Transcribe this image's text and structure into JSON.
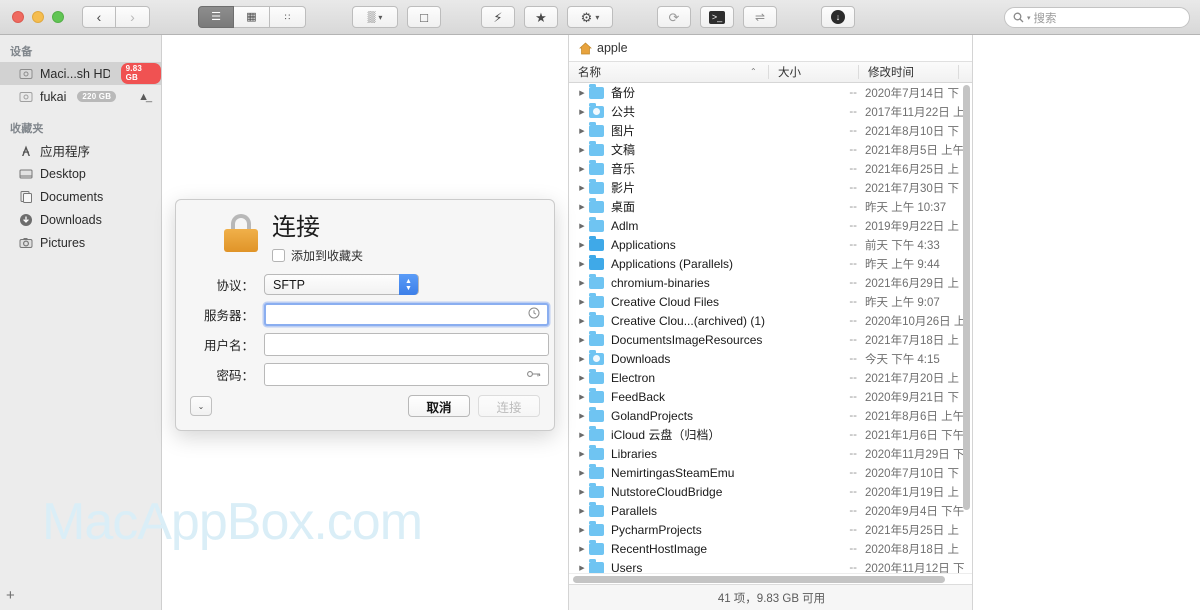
{
  "window": {
    "traffic_lights": [
      "close",
      "minimize",
      "zoom"
    ],
    "nav": {
      "back": "‹",
      "forward": "›"
    }
  },
  "toolbar": {
    "view_modes": [
      {
        "name": "list-view",
        "glyph": "☰",
        "active": true
      },
      {
        "name": "column-view",
        "glyph": "▦",
        "active": false
      },
      {
        "name": "gallery-view",
        "glyph": "∷",
        "active": false
      }
    ],
    "group_actions": [
      {
        "name": "arrange-button",
        "glyph": "▒",
        "has_chevron": true
      },
      {
        "name": "new-document-button",
        "glyph": "□",
        "has_chevron": false
      },
      {
        "name": "quick-action-button",
        "glyph": "⚡",
        "has_chevron": false
      },
      {
        "name": "favorites-button",
        "glyph": "★",
        "has_chevron": false
      },
      {
        "name": "settings-button",
        "glyph": "⚙",
        "has_chevron": true
      },
      {
        "name": "refresh-button",
        "glyph": "⟳",
        "has_chevron": false
      },
      {
        "name": "terminal-button",
        "glyph": "⬛",
        "has_chevron": false
      },
      {
        "name": "sync-button",
        "glyph": "⇌",
        "has_chevron": false
      },
      {
        "name": "download-button",
        "glyph": "↓",
        "has_chevron": false
      }
    ],
    "search": {
      "placeholder": "搜索",
      "icon": "search-icon"
    }
  },
  "sidebar": {
    "sections": [
      {
        "title": "设备",
        "items": [
          {
            "label": "Maci...sh HD",
            "icon": "hard-drive-icon",
            "badge": "9.83 GB",
            "badge_color": "#f05252",
            "selected": true,
            "eject": false
          },
          {
            "label": "fukai",
            "icon": "hard-drive-icon",
            "badge": "220 GB",
            "badge_color": "#b9b9b9",
            "selected": false,
            "eject": true
          }
        ]
      },
      {
        "title": "收藏夹",
        "items": [
          {
            "label": "应用程序",
            "icon": "applications-icon",
            "badge": "",
            "selected": false,
            "eject": false
          },
          {
            "label": "Desktop",
            "icon": "desktop-icon",
            "badge": "",
            "selected": false,
            "eject": false
          },
          {
            "label": "Documents",
            "icon": "documents-icon",
            "badge": "",
            "selected": false,
            "eject": false
          },
          {
            "label": "Downloads",
            "icon": "downloads-icon",
            "badge": "",
            "selected": false,
            "eject": false
          },
          {
            "label": "Pictures",
            "icon": "pictures-icon",
            "badge": "",
            "selected": false,
            "eject": false
          }
        ]
      }
    ],
    "add_button": "+"
  },
  "watermark": {
    "text": "MacAppBox.com",
    "color": "#daeef7"
  },
  "filepanel": {
    "path": {
      "icon": "home-icon",
      "name": "apple"
    },
    "columns": [
      {
        "label": "名称",
        "sorted": true,
        "sort_caret": "⌃"
      },
      {
        "label": "大小",
        "sorted": false,
        "sort_caret": ""
      },
      {
        "label": "修改时间",
        "sorted": false,
        "sort_caret": ""
      }
    ],
    "rows": [
      {
        "name": "备份",
        "size": "--",
        "date": "2020年7月14日 下",
        "icon_variant": "plain"
      },
      {
        "name": "公共",
        "size": "--",
        "date": "2017年11月22日 上",
        "icon_variant": "dot"
      },
      {
        "name": "图片",
        "size": "--",
        "date": "2021年8月10日 下",
        "icon_variant": "plain"
      },
      {
        "name": "文稿",
        "size": "--",
        "date": "2021年8月5日 上午",
        "icon_variant": "plain"
      },
      {
        "name": "音乐",
        "size": "--",
        "date": "2021年6月25日 上",
        "icon_variant": "plain"
      },
      {
        "name": "影片",
        "size": "--",
        "date": "2021年7月30日 下",
        "icon_variant": "plain"
      },
      {
        "name": "桌面",
        "size": "--",
        "date": "昨天 上午 10:37",
        "icon_variant": "plain"
      },
      {
        "name": "Adlm",
        "size": "--",
        "date": "2019年9月22日 上",
        "icon_variant": "plain"
      },
      {
        "name": "Applications",
        "size": "--",
        "date": "前天 下午 4:33",
        "icon_variant": "dark"
      },
      {
        "name": "Applications (Parallels)",
        "size": "--",
        "date": "昨天 上午 9:44",
        "icon_variant": "dark"
      },
      {
        "name": "chromium-binaries",
        "size": "--",
        "date": "2021年6月29日 上",
        "icon_variant": "plain"
      },
      {
        "name": "Creative Cloud Files",
        "size": "--",
        "date": "昨天 上午 9:07",
        "icon_variant": "plain"
      },
      {
        "name": "Creative Clou...(archived) (1)",
        "size": "--",
        "date": "2020年10月26日 上",
        "icon_variant": "plain"
      },
      {
        "name": "DocumentsImageResources",
        "size": "--",
        "date": "2021年7月18日 上",
        "icon_variant": "plain"
      },
      {
        "name": "Downloads",
        "size": "--",
        "date": "今天 下午 4:15",
        "icon_variant": "dot"
      },
      {
        "name": "Electron",
        "size": "--",
        "date": "2021年7月20日 上",
        "icon_variant": "plain"
      },
      {
        "name": "FeedBack",
        "size": "--",
        "date": "2020年9月21日 下",
        "icon_variant": "plain"
      },
      {
        "name": "GolandProjects",
        "size": "--",
        "date": "2021年8月6日 上午",
        "icon_variant": "plain"
      },
      {
        "name": "iCloud 云盘（归档）",
        "size": "--",
        "date": "2021年1月6日 下午",
        "icon_variant": "plain"
      },
      {
        "name": "Libraries",
        "size": "--",
        "date": "2020年11月29日 下",
        "icon_variant": "plain"
      },
      {
        "name": "NemirtingasSteamEmu",
        "size": "--",
        "date": "2020年7月10日 下",
        "icon_variant": "plain"
      },
      {
        "name": "NutstoreCloudBridge",
        "size": "--",
        "date": "2020年1月19日 上",
        "icon_variant": "plain"
      },
      {
        "name": "Parallels",
        "size": "--",
        "date": "2020年9月4日 下午",
        "icon_variant": "plain"
      },
      {
        "name": "PycharmProjects",
        "size": "--",
        "date": "2021年5月25日 上",
        "icon_variant": "plain"
      },
      {
        "name": "RecentHostImage",
        "size": "--",
        "date": "2020年8月18日 上",
        "icon_variant": "plain"
      },
      {
        "name": "Users",
        "size": "--",
        "date": "2020年11月12日 下",
        "icon_variant": "plain"
      }
    ],
    "status": "41 项，9.83 GB 可用"
  },
  "dialog": {
    "title": "连接",
    "icon": "lock-icon",
    "favorite_checkbox": {
      "label": "添加到收藏夹",
      "checked": false
    },
    "fields": [
      {
        "label": "协议：",
        "type": "select",
        "value": "SFTP",
        "placeholder": "",
        "icon": "stepper-icon",
        "focused": false
      },
      {
        "label": "服务器：",
        "type": "text",
        "value": "",
        "placeholder": "",
        "icon": "history-clock-icon",
        "focused": true
      },
      {
        "label": "用户名：",
        "type": "text",
        "value": "",
        "placeholder": "",
        "icon": "",
        "focused": false
      },
      {
        "label": "密码：",
        "type": "text",
        "value": "",
        "placeholder": "",
        "icon": "key-icon",
        "focused": false
      }
    ],
    "disclosure_glyph": "⌄",
    "buttons": [
      {
        "label": "取消",
        "name": "cancel-button",
        "style": "cancel",
        "disabled": false
      },
      {
        "label": "连接",
        "name": "connect-button",
        "style": "connect",
        "disabled": true
      }
    ]
  }
}
